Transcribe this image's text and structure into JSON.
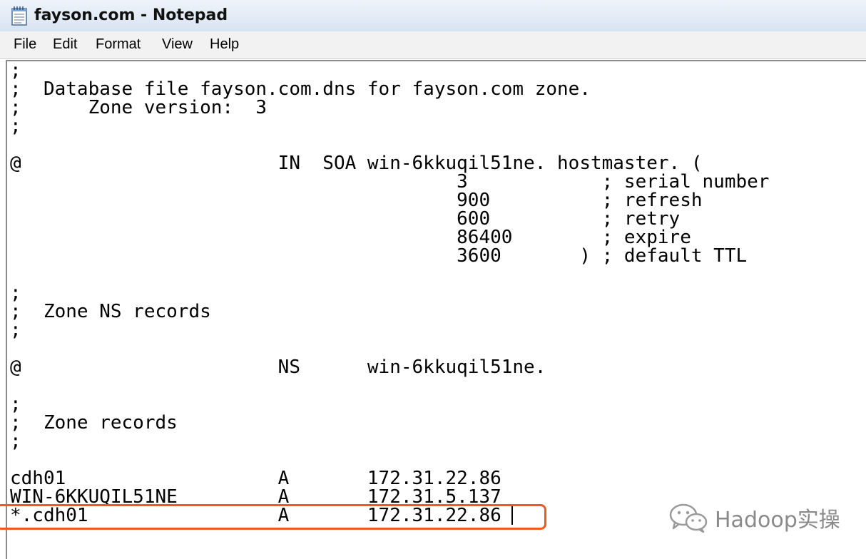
{
  "window": {
    "title": "fayson.com - Notepad",
    "icon": "notepad-icon"
  },
  "menu": {
    "items": [
      "File",
      "Edit",
      "Format",
      "View",
      "Help"
    ]
  },
  "editor": {
    "lines": [
      ";",
      ";  Database file fayson.com.dns for fayson.com zone.",
      ";      Zone version:  3",
      ";",
      "",
      "@                       IN  SOA win-6kkuqil51ne. hostmaster. (",
      "                                        3            ; serial number",
      "                                        900          ; refresh",
      "                                        600          ; retry",
      "                                        86400        ; expire",
      "                                        3600       ) ; default TTL",
      "",
      ";",
      ";  Zone NS records",
      ";",
      "",
      "@                       NS      win-6kkuqil51ne.",
      "",
      ";",
      ";  Zone records",
      ";",
      "",
      "cdh01                   A       172.31.22.86",
      "WIN-6KKUQIL51NE         A       172.31.5.137",
      "*.cdh01                 A       172.31.22.86"
    ],
    "highlighted_line": "*.cdh01                 A       172.31.22.86",
    "highlight_color": "#f05a22"
  },
  "watermark": {
    "text": "Hadoop实操",
    "logo": "wechat-icon"
  }
}
